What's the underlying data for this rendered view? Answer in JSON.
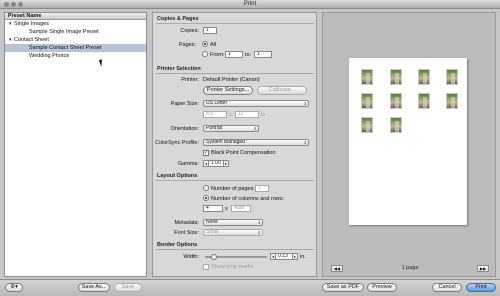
{
  "window": {
    "title": "Print"
  },
  "presets": {
    "header": "Preset Name",
    "items": [
      {
        "label": "Single Images",
        "level": 0,
        "expanded": true
      },
      {
        "label": "Sample Single Image Preset",
        "level": 1
      },
      {
        "label": "Contact Sheet",
        "level": 0,
        "expanded": true
      },
      {
        "label": "Sample Contact Sheet Preset",
        "level": 1,
        "selected": true
      },
      {
        "label": "Wedding Photos",
        "level": 1
      }
    ]
  },
  "copies": {
    "section": "Copies & Pages",
    "copies_label": "Copies:",
    "copies_value": "1",
    "pages_label": "Pages:",
    "all_label": "All",
    "from_label": "From:",
    "from_value": "1",
    "to_label": "to:",
    "to_value": "1"
  },
  "printer": {
    "section": "Printer Selection",
    "printer_label": "Printer:",
    "printer_value": "Default Printer (Canon)",
    "settings_button": "Printer Settings...",
    "calibrate_button": "Calibrate...",
    "paper_label": "Paper Size:",
    "paper_value": "US Letter",
    "width_value": "8.5",
    "x_label": "x",
    "height_value": "11",
    "unit_label": "in",
    "orientation_label": "Orientation:",
    "orientation_value": "Portrait",
    "colorsync_label": "ColorSync Profile:",
    "colorsync_value": "System Managed",
    "bpc_label": "Black Point Compensation",
    "gamma_label": "Gamma:",
    "gamma_value": "1.00"
  },
  "layout": {
    "section": "Layout Options",
    "num_pages_label": "Number of pages:",
    "num_pages_value": "1",
    "cols_rows_label": "Number of columns and rows:",
    "cols_value": "4",
    "rows_value": "Auto",
    "metadata_label": "Metadata:",
    "metadata_value": "None",
    "font_label": "Font Size:",
    "font_value": "Small"
  },
  "border": {
    "section": "Border Options",
    "width_label": "Width:",
    "width_value": "0.13",
    "unit_label": "in.",
    "crop_label": "Show crop marks",
    "slider_fraction": 0.1
  },
  "preview": {
    "page_count": "1 page",
    "prev_icon": "◀◀",
    "next_icon": "▶▶"
  },
  "bottom": {
    "gear_icon": "⚙▾",
    "save_as": "Save As...",
    "save": "Save",
    "save_pdf": "Save as PDF",
    "preview": "Preview",
    "cancel": "Cancel",
    "print": "Print"
  }
}
